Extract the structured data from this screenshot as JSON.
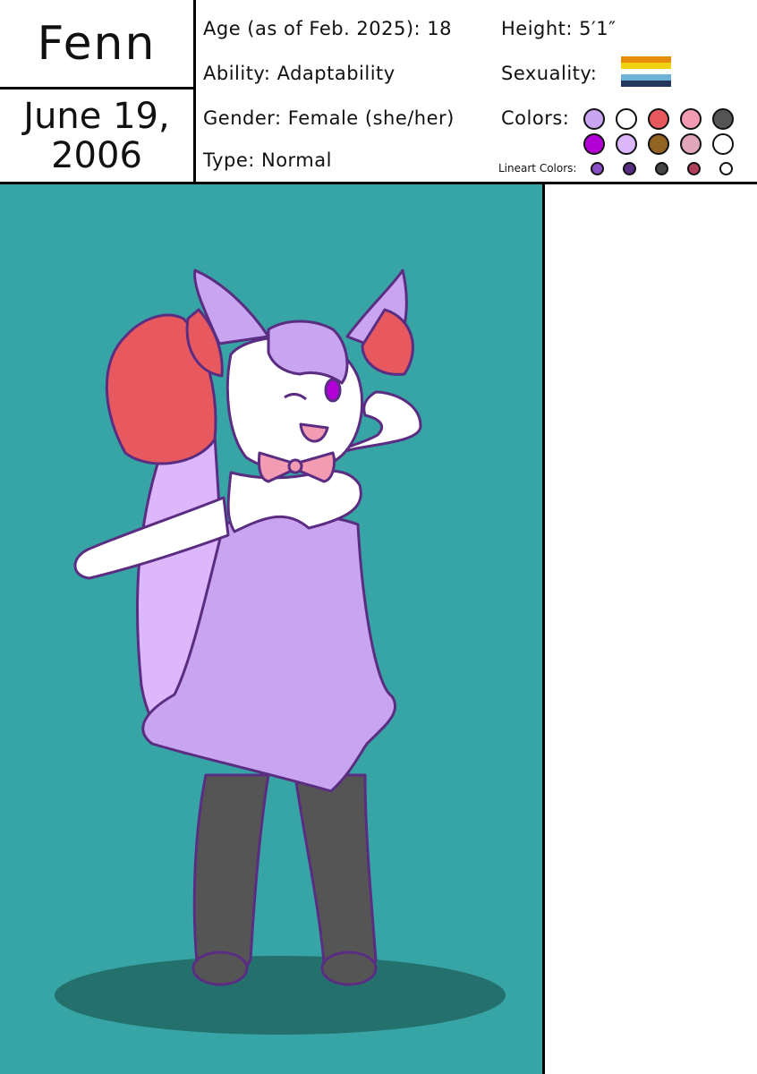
{
  "character": {
    "name": "Fenn",
    "birthday_line1": "June 19,",
    "birthday_line2": "2006"
  },
  "info": {
    "age": "Age (as of Feb. 2025): 18",
    "ability": "Ability: Adaptability",
    "gender": "Gender: Female (she/her)",
    "type": "Type: Normal",
    "height": "Height: 5′1″",
    "sexuality_label": "Sexuality:",
    "colors_label": "Colors:",
    "lineart_label": "Lineart Colors:"
  },
  "sexuality_flag": [
    "#e58c0a",
    "#f0d20f",
    "#ffffff",
    "#6fb2d8",
    "#23365c"
  ],
  "colors_row1": [
    "#c9a4f0",
    "#ffffff",
    "#e8585f",
    "#f29bb2",
    "#555555"
  ],
  "colors_row2": [
    "#b300d6",
    "#ddb7fc",
    "#936324",
    "#e0a7bb",
    "#ffffff"
  ],
  "lineart_colors": [
    "#8a4fc6",
    "#5a2d82",
    "#444444",
    "#b03f59",
    "#ffffff"
  ],
  "palette": {
    "background": "#37a5a5",
    "shadow": "#23706c",
    "fur_purple": "#c9a4f0",
    "fur_light_purple": "#ddb7fc",
    "fur_red": "#e8585f",
    "fur_white": "#ffffff",
    "bow_pink": "#f29bb2",
    "legs_gray": "#555555",
    "eye_magenta": "#b300d6",
    "lineart": "#5a2d82"
  }
}
